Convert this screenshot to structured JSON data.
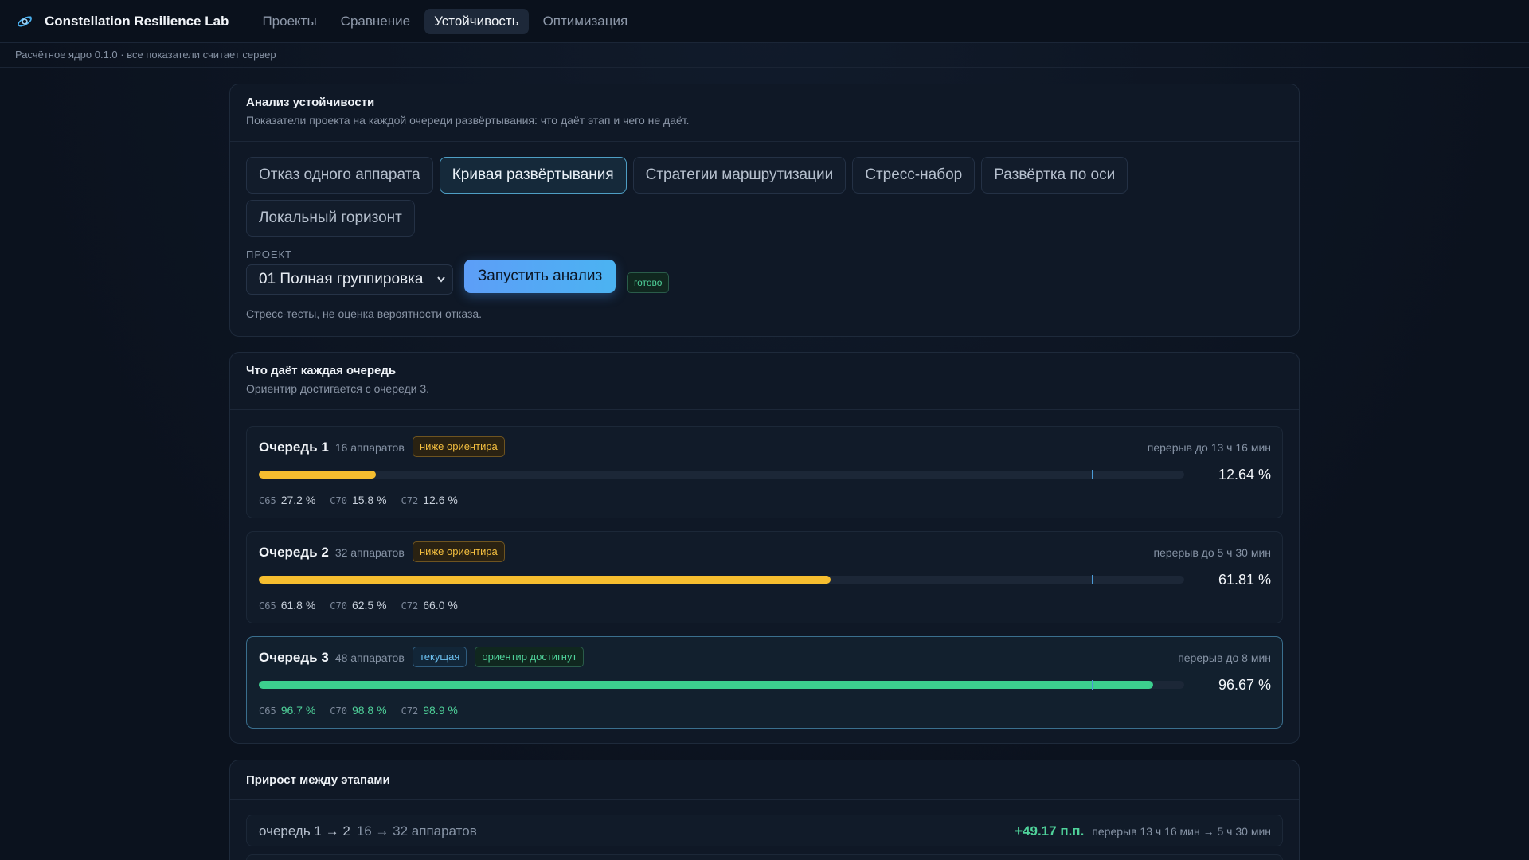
{
  "app": {
    "title": "Constellation Resilience Lab",
    "nav": [
      "Проекты",
      "Сравнение",
      "Устойчивость",
      "Оптимизация"
    ],
    "active_nav": "Устойчивость",
    "subtitle": "Расчётное ядро 0.1.0 · все показатели считает сервер"
  },
  "analysis": {
    "title": "Анализ устойчивости",
    "subtitle": "Показатели проекта на каждой очереди развёртывания: что даёт этап и чего не даёт.",
    "tabs": [
      "Отказ одного аппарата",
      "Кривая развёртывания",
      "Стратегии маршрутизации",
      "Стресс-набор",
      "Развёртка по оси",
      "Локальный горизонт"
    ],
    "active_tab": "Кривая развёртывания",
    "project_label": "ПРОЕКТ",
    "project_value": "01 Полная группировка",
    "run_label": "Запустить анализ",
    "status": "готово",
    "disclaimer": "Стресс-тесты, не оценка вероятности отказа."
  },
  "queues": {
    "title": "Что даёт каждая очередь",
    "subtitle": "Ориентир достигается с очереди 3.",
    "target_percent": 90,
    "colors": {
      "warn": "#f6be2f",
      "ok": "#3ccf8e"
    },
    "items": [
      {
        "title": "Очередь 1",
        "count": "16 аппаратов",
        "badges": [
          {
            "text": "ниже ориентира",
            "kind": "warn"
          }
        ],
        "gap": "перерыв до 13 ч 16 мин",
        "percent": 12.64,
        "value": "12.64 %",
        "status": "warn",
        "current": false,
        "stats": [
          {
            "k": "C65",
            "v": "27.2 %"
          },
          {
            "k": "C70",
            "v": "15.8 %"
          },
          {
            "k": "C72",
            "v": "12.6 %"
          }
        ]
      },
      {
        "title": "Очередь 2",
        "count": "32 аппаратов",
        "badges": [
          {
            "text": "ниже ориентира",
            "kind": "warn"
          }
        ],
        "gap": "перерыв до 5 ч 30 мин",
        "percent": 61.81,
        "value": "61.81 %",
        "status": "warn",
        "current": false,
        "stats": [
          {
            "k": "C65",
            "v": "61.8 %"
          },
          {
            "k": "C70",
            "v": "62.5 %"
          },
          {
            "k": "C72",
            "v": "66.0 %"
          }
        ]
      },
      {
        "title": "Очередь 3",
        "count": "48 аппаратов",
        "badges": [
          {
            "text": "текущая",
            "kind": "cur"
          },
          {
            "text": "ориентир достигнут",
            "kind": "ok"
          }
        ],
        "gap": "перерыв до 8 мин",
        "percent": 96.67,
        "value": "96.67 %",
        "status": "ok",
        "current": true,
        "stats": [
          {
            "k": "C65",
            "v": "96.7 %"
          },
          {
            "k": "C70",
            "v": "98.8 %"
          },
          {
            "k": "C72",
            "v": "98.9 %"
          }
        ]
      }
    ]
  },
  "growth": {
    "title": "Прирост между этапами",
    "rows": [
      {
        "label": "очередь 1 → 2",
        "sub": "16 → 32 аппаратов",
        "delta": "+49.17 п.п.",
        "note": "перерыв 13 ч 16 мин → 5 ч 30 мин"
      }
    ]
  }
}
